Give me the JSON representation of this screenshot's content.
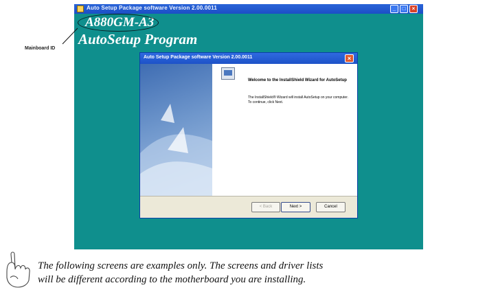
{
  "window": {
    "title": "Auto Setup Package software Version 2.00.0011",
    "minimize_label": "_",
    "maximize_label": "□",
    "close_label": "×"
  },
  "branding": {
    "board_id": "A880GM-A3",
    "program_title": "AutoSetup Program"
  },
  "callout": {
    "label": "Mainboard ID"
  },
  "dialog": {
    "title": "Auto Setup Package software Version 2.00.0011",
    "close_label": "×",
    "welcome_heading": "Welcome to the InstallShield Wizard for AutoSetup",
    "body": "The InstallShield® Wizard will install AutoSetup on your computer.  To continue, click Next.",
    "buttons": {
      "back": "< Back",
      "next": "Next >",
      "cancel": "Cancel"
    }
  },
  "note": {
    "line1": "The following screens are examples only. The screens and driver lists",
    "line2": "will be different according to the motherboard you are installing."
  },
  "colors": {
    "desktop_bg": "#0f8f8d",
    "titlebar": "#1d52c8",
    "dialog_face": "#ece9d8"
  }
}
